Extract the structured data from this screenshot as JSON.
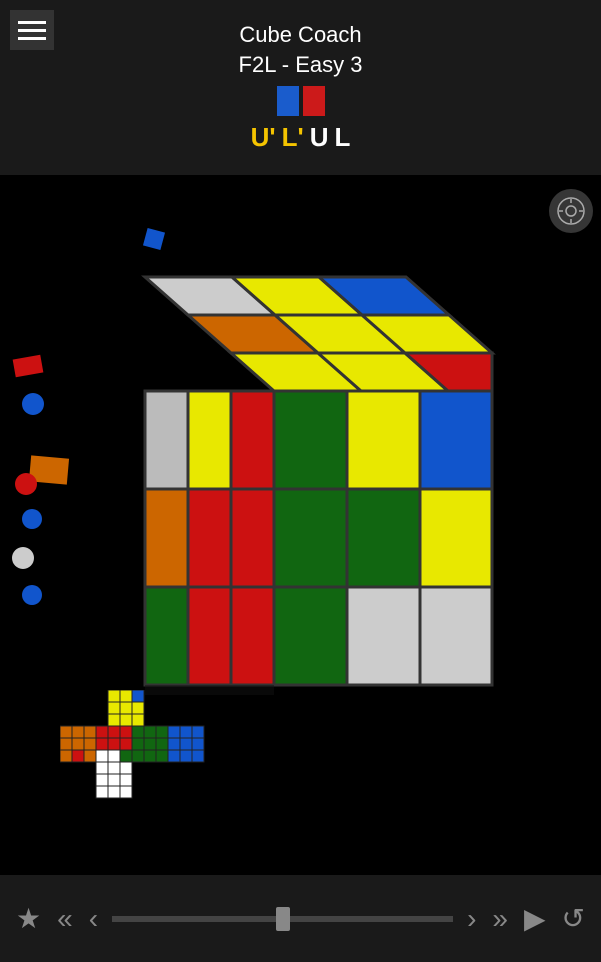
{
  "header": {
    "title": "Cube Coach",
    "subtitle": "F2L - Easy 3",
    "moves": [
      {
        "text": "U'",
        "color": "yellow"
      },
      {
        "text": "L'",
        "color": "yellow"
      },
      {
        "text": "U",
        "color": "white"
      },
      {
        "text": "L",
        "color": "white"
      }
    ]
  },
  "toolbar": {
    "star_label": "★",
    "rewind_label": "«",
    "back_label": "‹",
    "forward_label": "›",
    "fast_forward_label": "»",
    "play_label": "▶",
    "refresh_label": "↺"
  },
  "colors": {
    "header_bg": "#1a1a1a",
    "main_bg": "#000000",
    "toolbar_bg": "#1a1a1a"
  }
}
